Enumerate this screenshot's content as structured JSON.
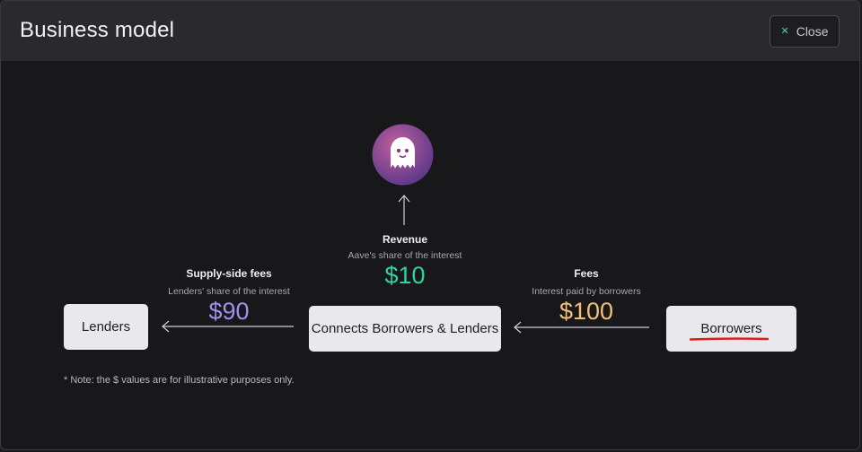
{
  "header": {
    "title": "Business model",
    "close_label": "Close",
    "close_icon": "close-icon"
  },
  "revenue": {
    "title": "Revenue",
    "subtitle": "Aave's share of the interest",
    "amount": "$10",
    "color": "#2ed3a0"
  },
  "supply_side": {
    "title": "Supply-side fees",
    "subtitle": "Lenders' share of the interest",
    "amount": "$90",
    "color": "#a08ff0"
  },
  "fees": {
    "title": "Fees",
    "subtitle": "Interest paid by borrowers",
    "amount": "$100",
    "color": "#f2bf78"
  },
  "boxes": {
    "lenders": "Lenders",
    "protocol": "Connects Borrowers & Lenders",
    "borrowers": "Borrowers"
  },
  "note": "* Note: the $ values are for illustrative purposes only.",
  "logo": {
    "icon": "ghost-icon",
    "gradient_start": "#b35a9a",
    "gradient_end": "#5b3a8a"
  },
  "annotation": {
    "underline_color": "#e01818"
  }
}
